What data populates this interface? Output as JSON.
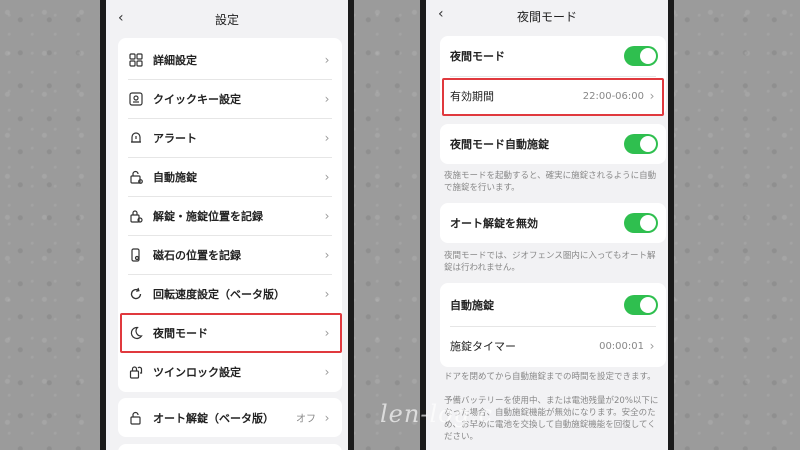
{
  "left": {
    "title": "設定",
    "items": [
      {
        "label": "詳細設定",
        "icon": "grid-icon"
      },
      {
        "label": "クイックキー設定",
        "icon": "keypad-icon"
      },
      {
        "label": "アラート",
        "icon": "alert-bell-icon"
      },
      {
        "label": "自動施錠",
        "icon": "auto-lock-icon"
      },
      {
        "label": "解錠・施錠位置を記録",
        "icon": "lock-gear-icon"
      },
      {
        "label": "磁石の位置を記録",
        "icon": "phone-magnet-icon"
      },
      {
        "label": "回転速度設定（ベータ版）",
        "icon": "rotate-icon"
      },
      {
        "label": "夜間モード",
        "icon": "moon-icon"
      },
      {
        "label": "ツインロック設定",
        "icon": "twin-lock-icon"
      }
    ],
    "auto_unlock": {
      "label": "オート解錠（ベータ版）",
      "value": "オフ",
      "icon": "unlock-icon"
    }
  },
  "right": {
    "title": "夜間モード",
    "night_mode": {
      "label": "夜間モード",
      "enabled": true
    },
    "valid_period": {
      "label": "有効期間",
      "value": "22:00-06:00"
    },
    "auto_lock": {
      "label": "夜間モード自動施錠",
      "enabled": true
    },
    "auto_lock_note": "夜施モードを起動すると、確実に施錠されるように自動で施錠を行います。",
    "auto_unlock_off": {
      "label": "オート解錠を無効",
      "enabled": true
    },
    "auto_unlock_note": "夜間モードでは、ジオフェンス圏内に入ってもオート解錠は行われません。",
    "auto_lock2": {
      "label": "自動施錠",
      "enabled": true
    },
    "lock_timer": {
      "label": "施錠タイマー",
      "value": "00:00:01"
    },
    "bottom_note_1": "ドアを閉めてから自動施錠までの時間を設定できます。",
    "bottom_note_2": "予備バッテリーを使用中、または電池残量が20%以下になった場合、自動施錠機能が無効になります。安全のため、お早めに電池を交換して自動施錠機能を回復してください。"
  },
  "watermark": "len-log.c",
  "colors": {
    "toggle_on": "#2fbf4f",
    "highlight": "#e0393e"
  }
}
